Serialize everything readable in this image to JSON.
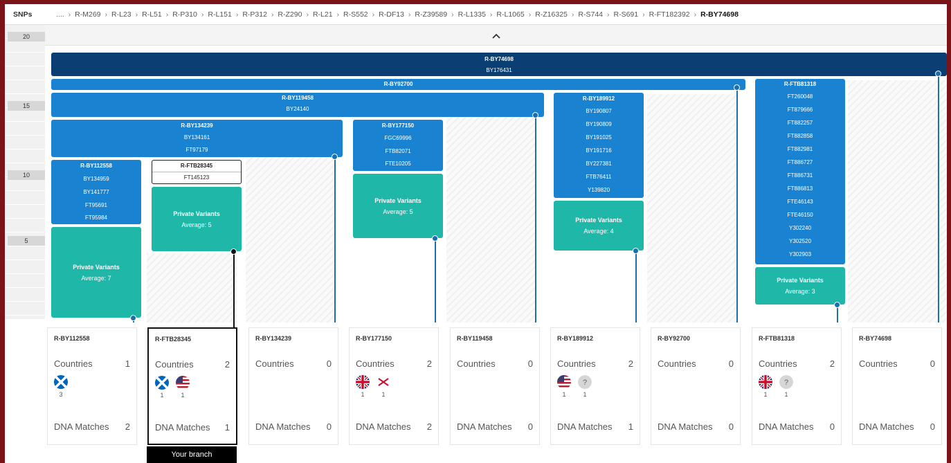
{
  "snp_bar": {
    "label": "SNPs",
    "crumbs": [
      "....",
      "R-M269",
      "R-L23",
      "R-L51",
      "R-P310",
      "R-L151",
      "R-P312",
      "R-Z290",
      "R-L21",
      "R-S552",
      "R-DF13",
      "R-Z39589",
      "R-L1335",
      "R-L1065",
      "R-Z16325",
      "R-S744",
      "R-S691",
      "R-FT182392",
      "R-BY74698"
    ]
  },
  "axis": {
    "ticks": [
      "20",
      "15",
      "10",
      "5"
    ]
  },
  "collapse_icon": "chevron-up",
  "blocks": {
    "root": {
      "name": "R-BY74698",
      "snps": [
        "BY176431"
      ]
    },
    "by92700": {
      "name": "R-BY92700",
      "snps": []
    },
    "by119458": {
      "name": "R-BY119458",
      "snps": [
        "BY24140"
      ]
    },
    "by134239": {
      "name": "R-BY134239",
      "snps": [
        "BY134161",
        "FT97179"
      ]
    },
    "by112558": {
      "name": "R-BY112558",
      "snps": [
        "BY134959",
        "BY141777",
        "FT95691",
        "FT95984"
      ]
    },
    "ftb28345": {
      "name": "R-FTB28345",
      "snps": [
        "FT145123"
      ]
    },
    "by177150": {
      "name": "R-BY177150",
      "snps": [
        "FGC69996",
        "FTB82071",
        "FTE10205"
      ]
    },
    "by189912": {
      "name": "R-BY189912",
      "snps": [
        "BY190807",
        "BY190809",
        "BY191025",
        "BY191716",
        "BY227381",
        "FTB76411",
        "Y139820"
      ]
    },
    "ftb81318": {
      "name": "R-FTB81318",
      "snps": [
        "FT260048",
        "FT879666",
        "FT882257",
        "FT882858",
        "FT882981",
        "FT886727",
        "FT886731",
        "FT886813",
        "FTE46143",
        "FTE46150",
        "Y302240",
        "Y302520",
        "Y302903"
      ]
    }
  },
  "private_variants": {
    "title": "Private Variants",
    "by112558": "Average: 7",
    "ftb28345": "Average: 5",
    "by177150": "Average: 5",
    "by189912": "Average: 4",
    "ftb81318": "Average: 3"
  },
  "cards": [
    {
      "id": "R-BY112558",
      "countries_label": "Countries",
      "countries": "1",
      "flags": [
        {
          "icon": "scotland-flag",
          "count": "3"
        }
      ],
      "matches_label": "DNA Matches",
      "matches": "2"
    },
    {
      "id": "R-FTB28345",
      "countries_label": "Countries",
      "countries": "2",
      "flags": [
        {
          "icon": "scotland-flag",
          "count": "1"
        },
        {
          "icon": "usa-flag",
          "count": "1"
        }
      ],
      "matches_label": "DNA Matches",
      "matches": "1"
    },
    {
      "id": "R-BY134239",
      "countries_label": "Countries",
      "countries": "0",
      "flags": [],
      "matches_label": "DNA Matches",
      "matches": "0"
    },
    {
      "id": "R-BY177150",
      "countries_label": "Countries",
      "countries": "2",
      "flags": [
        {
          "icon": "uk-flag",
          "count": "1"
        },
        {
          "icon": "northern-ireland-flag",
          "count": "1"
        }
      ],
      "matches_label": "DNA Matches",
      "matches": "2"
    },
    {
      "id": "R-BY119458",
      "countries_label": "Countries",
      "countries": "0",
      "flags": [],
      "matches_label": "DNA Matches",
      "matches": "0"
    },
    {
      "id": "R-BY189912",
      "countries_label": "Countries",
      "countries": "2",
      "flags": [
        {
          "icon": "usa-flag",
          "count": "1"
        },
        {
          "icon": "unknown-flag",
          "count": "1"
        }
      ],
      "matches_label": "DNA Matches",
      "matches": "1"
    },
    {
      "id": "R-BY92700",
      "countries_label": "Countries",
      "countries": "0",
      "flags": [],
      "matches_label": "DNA Matches",
      "matches": "0"
    },
    {
      "id": "R-FTB81318",
      "countries_label": "Countries",
      "countries": "2",
      "flags": [
        {
          "icon": "uk-flag",
          "count": "1"
        },
        {
          "icon": "unknown-flag",
          "count": "1"
        }
      ],
      "matches_label": "DNA Matches",
      "matches": "0"
    },
    {
      "id": "R-BY74698",
      "countries_label": "Countries",
      "countries": "0",
      "flags": [],
      "matches_label": "DNA Matches",
      "matches": "0"
    }
  ],
  "your_branch_label": "Your branch",
  "colors": {
    "dark": "#0b3f73",
    "mid": "#1a83d1",
    "teal": "#1fb7a8",
    "line": "#1a6fb3"
  }
}
